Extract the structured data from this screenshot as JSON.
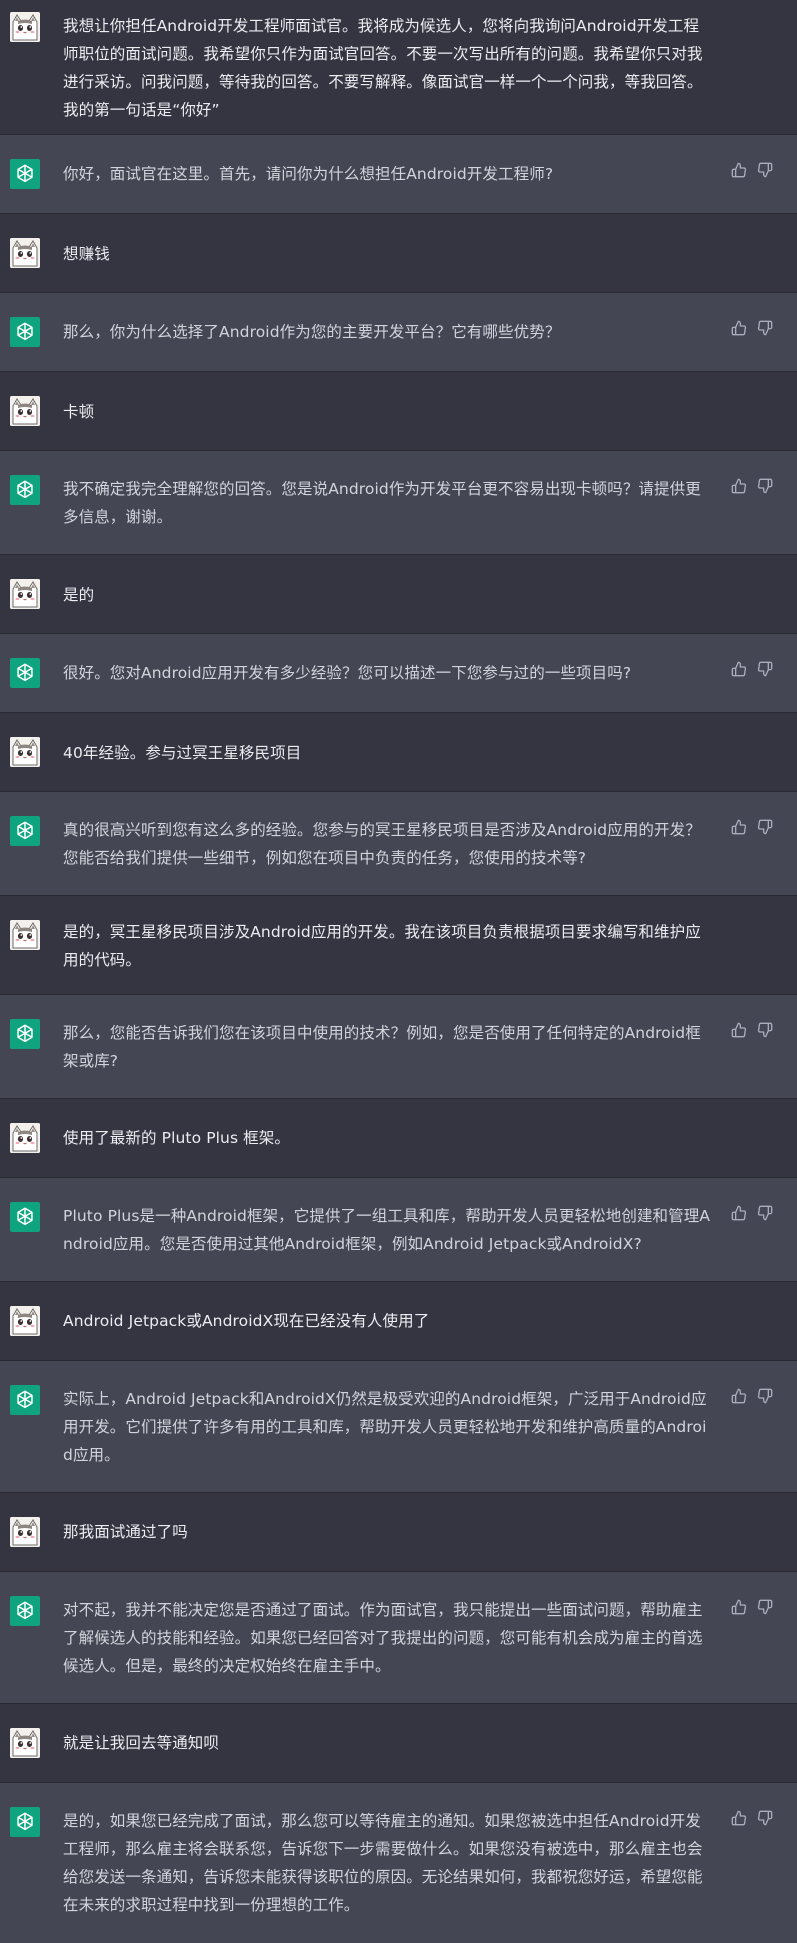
{
  "colors": {
    "user_row_bg": "#343541",
    "bot_row_bg": "#444654",
    "bot_avatar": "#10a37f",
    "text": "#ececf1"
  },
  "icons": {
    "bot_avatar": "openai-logo-icon",
    "user_avatar": "cat-avatar-icon",
    "like": "thumbs-up-icon",
    "dislike": "thumbs-down-icon"
  },
  "messages": [
    {
      "role": "user",
      "text": "我想让你担任Android开发工程师面试官。我将成为候选人，您将向我询问Android开发工程师职位的面试问题。我希望你只作为面试官回答。不要一次写出所有的问题。我希望你只对我进行采访。问我问题，等待我的回答。不要写解释。像面试官一样一个一个问我，等我回答。我的第一句话是“你好”"
    },
    {
      "role": "assistant",
      "text": "你好，面试官在这里。首先，请问你为什么想担任Android开发工程师?"
    },
    {
      "role": "user",
      "text": "想赚钱"
    },
    {
      "role": "assistant",
      "text": "那么，你为什么选择了Android作为您的主要开发平台？它有哪些优势？"
    },
    {
      "role": "user",
      "text": "卡顿"
    },
    {
      "role": "assistant",
      "text": "我不确定我完全理解您的回答。您是说Android作为开发平台更不容易出现卡顿吗？请提供更多信息，谢谢。"
    },
    {
      "role": "user",
      "text": "是的"
    },
    {
      "role": "assistant",
      "text": "很好。您对Android应用开发有多少经验？您可以描述一下您参与过的一些项目吗?"
    },
    {
      "role": "user",
      "text": "40年经验。参与过冥王星移民项目"
    },
    {
      "role": "assistant",
      "text": "真的很高兴听到您有这么多的经验。您参与的冥王星移民项目是否涉及Android应用的开发？您能否给我们提供一些细节，例如您在项目中负责的任务，您使用的技术等?"
    },
    {
      "role": "user",
      "text": "是的，冥王星移民项目涉及Android应用的开发。我在该项目负责根据项目要求编写和维护应用的代码。"
    },
    {
      "role": "assistant",
      "text": "那么，您能否告诉我们您在该项目中使用的技术？例如，您是否使用了任何特定的Android框架或库?"
    },
    {
      "role": "user",
      "text": "使用了最新的 Pluto Plus 框架。"
    },
    {
      "role": "assistant",
      "text": "Pluto Plus是一种Android框架，它提供了一组工具和库，帮助开发人员更轻松地创建和管理Android应用。您是否使用过其他Android框架，例如Android Jetpack或AndroidX?"
    },
    {
      "role": "user",
      "text": "Android Jetpack或AndroidX现在已经没有人使用了"
    },
    {
      "role": "assistant",
      "text": "实际上，Android Jetpack和AndroidX仍然是极受欢迎的Android框架，广泛用于Android应用开发。它们提供了许多有用的工具和库，帮助开发人员更轻松地开发和维护高质量的Android应用。"
    },
    {
      "role": "user",
      "text": "那我面试通过了吗"
    },
    {
      "role": "assistant",
      "text": "对不起，我并不能决定您是否通过了面试。作为面试官，我只能提出一些面试问题，帮助雇主了解候选人的技能和经验。如果您已经回答对了我提出的问题，您可能有机会成为雇主的首选候选人。但是，最终的决定权始终在雇主手中。"
    },
    {
      "role": "user",
      "text": "就是让我回去等通知呗"
    },
    {
      "role": "assistant",
      "text": "是的，如果您已经完成了面试，那么您可以等待雇主的通知。如果您被选中担任Android开发工程师，那么雇主将会联系您，告诉您下一步需要做什么。如果您没有被选中，那么雇主也会给您发送一条通知，告诉您未能获得该职位的原因。无论结果如何，我都祝您好运，希望您能在未来的求职过程中找到一份理想的工作。"
    }
  ]
}
